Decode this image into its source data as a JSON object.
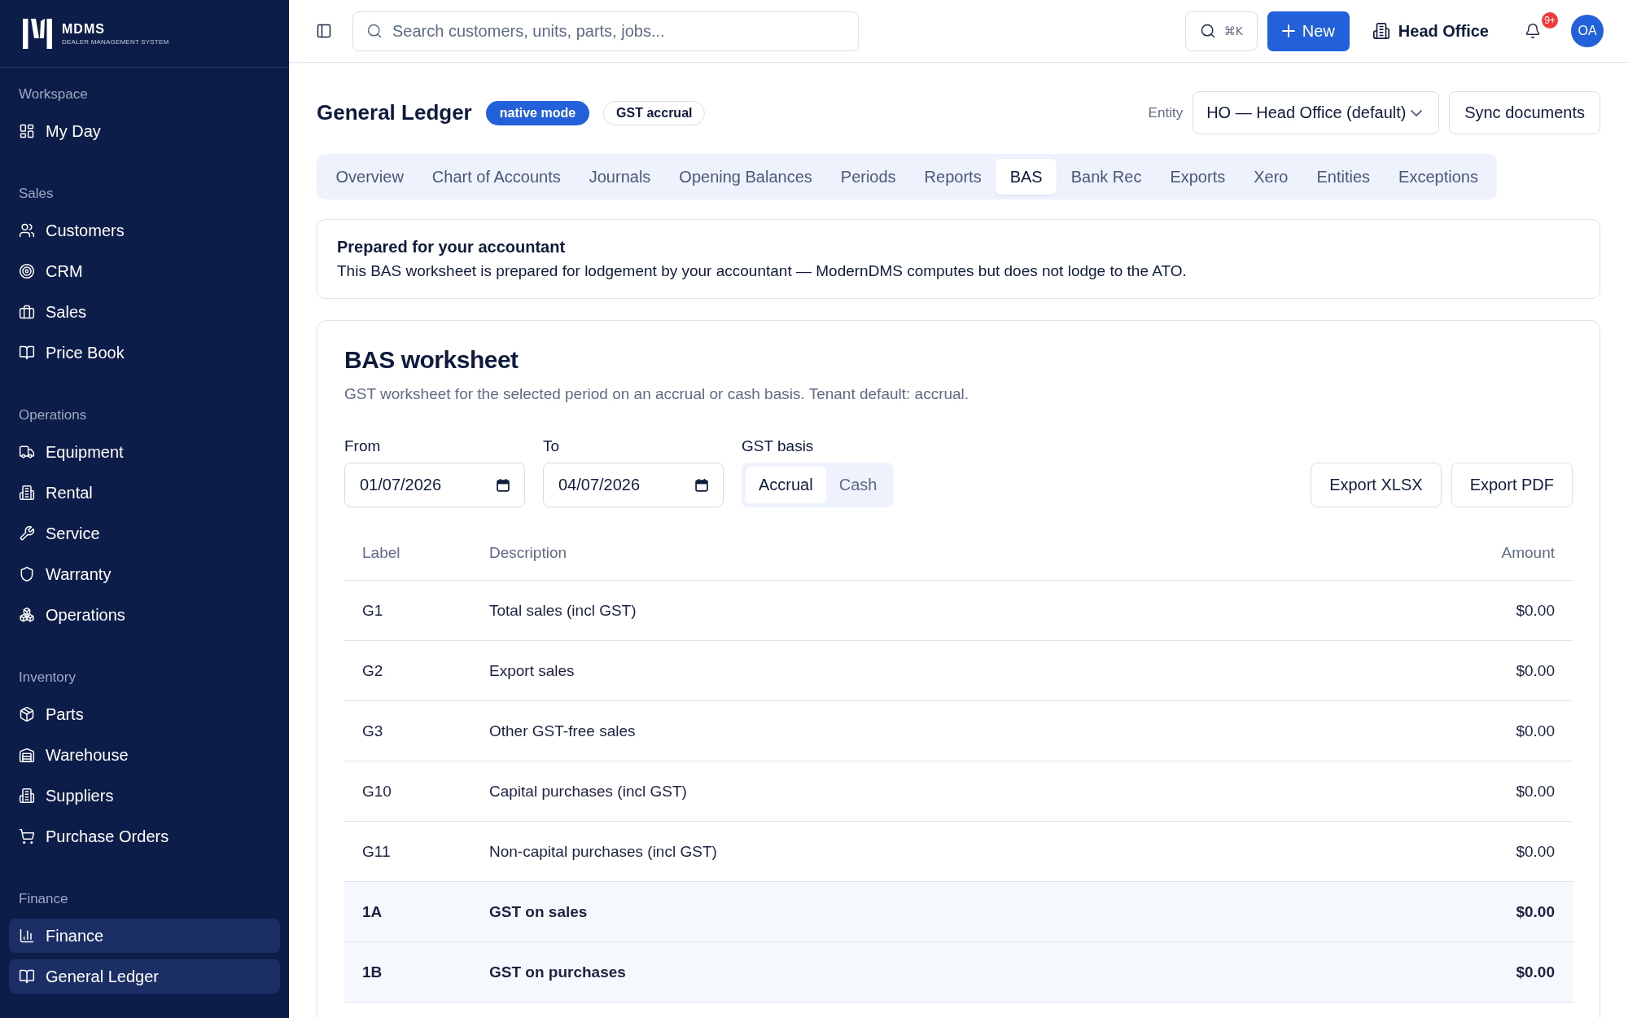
{
  "sidebar": {
    "logo": {
      "name": "MDMS",
      "tagline": "DEALER MANAGEMENT SYSTEM"
    },
    "sections": [
      {
        "title": "Workspace",
        "items": [
          {
            "label": "My Day",
            "selected": false
          }
        ]
      },
      {
        "title": "Sales",
        "items": [
          {
            "label": "Customers",
            "selected": false
          },
          {
            "label": "CRM",
            "selected": false
          },
          {
            "label": "Sales",
            "selected": false
          },
          {
            "label": "Price Book",
            "selected": false
          }
        ]
      },
      {
        "title": "Operations",
        "items": [
          {
            "label": "Equipment",
            "selected": false
          },
          {
            "label": "Rental",
            "selected": false
          },
          {
            "label": "Service",
            "selected": false
          },
          {
            "label": "Warranty",
            "selected": false
          },
          {
            "label": "Operations",
            "selected": false
          }
        ]
      },
      {
        "title": "Inventory",
        "items": [
          {
            "label": "Parts",
            "selected": false
          },
          {
            "label": "Warehouse",
            "selected": false
          },
          {
            "label": "Suppliers",
            "selected": false
          },
          {
            "label": "Purchase Orders",
            "selected": false
          }
        ]
      },
      {
        "title": "Finance",
        "items": [
          {
            "label": "Finance",
            "selected": true
          },
          {
            "label": "General Ledger",
            "selected": true
          }
        ]
      }
    ]
  },
  "topbar": {
    "search": {
      "placeholder": "Search customers, units, parts, jobs..."
    },
    "command_button": "⌘K",
    "new_button": "New",
    "location_button": "Head Office",
    "notifications": {
      "badge": "9+"
    },
    "avatar": "OA"
  },
  "header": {
    "title": "General Ledger",
    "badges": [
      {
        "label": "native mode",
        "kind": "filled"
      },
      {
        "label": "GST accrual",
        "kind": "outline"
      }
    ],
    "entity": {
      "label": "Entity",
      "value": "HO — Head Office (default)"
    },
    "sync_button": "Sync documents"
  },
  "tabs": [
    {
      "label": "Overview",
      "selected": false
    },
    {
      "label": "Chart of Accounts",
      "selected": false
    },
    {
      "label": "Journals",
      "selected": false
    },
    {
      "label": "Opening Balances",
      "selected": false
    },
    {
      "label": "Periods",
      "selected": false
    },
    {
      "label": "Reports",
      "selected": false
    },
    {
      "label": "BAS",
      "selected": true
    },
    {
      "label": "Bank Rec",
      "selected": false
    },
    {
      "label": "Exports",
      "selected": false
    },
    {
      "label": "Xero",
      "selected": false
    },
    {
      "label": "Entities",
      "selected": false
    },
    {
      "label": "Exceptions",
      "selected": false
    }
  ],
  "notice": {
    "title": "Prepared for your accountant",
    "text": "This BAS worksheet is prepared for lodgement by your accountant — ModernDMS computes but does not lodge to the ATO."
  },
  "worksheet": {
    "title": "BAS worksheet",
    "subtitle": "GST worksheet for the selected period on an accrual or cash basis. Tenant default: accrual.",
    "fields": [
      {
        "label": "From",
        "value": "01/07/2026"
      },
      {
        "label": "To",
        "value": "04/07/2026"
      }
    ],
    "basis": {
      "label": "GST basis",
      "options": [
        {
          "label": "Accrual",
          "selected": true
        },
        {
          "label": "Cash",
          "selected": false
        }
      ]
    },
    "buttons": [
      "Export XLSX",
      "Export PDF"
    ],
    "table": {
      "columns": [
        "Label",
        "Description",
        "Amount"
      ],
      "rows": [
        {
          "label": "G1",
          "description": "Total sales (incl GST)",
          "amount": "$0.00",
          "kind": "line"
        },
        {
          "label": "G2",
          "description": "Export sales",
          "amount": "$0.00",
          "kind": "line"
        },
        {
          "label": "G3",
          "description": "Other GST-free sales",
          "amount": "$0.00",
          "kind": "line"
        },
        {
          "label": "G10",
          "description": "Capital purchases (incl GST)",
          "amount": "$0.00",
          "kind": "line"
        },
        {
          "label": "G11",
          "description": "Non-capital purchases (incl GST)",
          "amount": "$0.00",
          "kind": "line"
        },
        {
          "label": "1A",
          "description": "GST on sales",
          "amount": "$0.00",
          "kind": "total"
        },
        {
          "label": "1B",
          "description": "GST on purchases",
          "amount": "$0.00",
          "kind": "total"
        }
      ]
    }
  }
}
